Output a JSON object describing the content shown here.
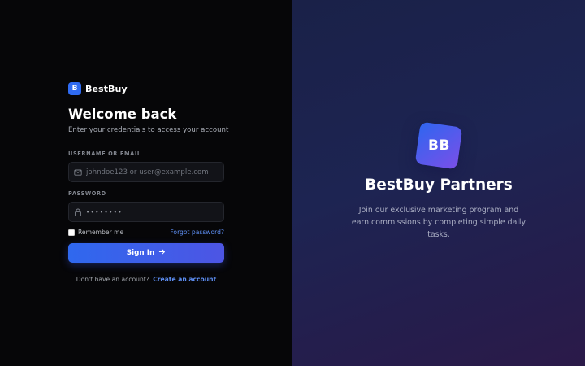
{
  "brand": {
    "logo_letter": "B",
    "name": "BestBuy"
  },
  "login": {
    "title": "Welcome back",
    "subtitle": "Enter your credentials to access your account",
    "username_label": "USERNAME OR EMAIL",
    "username_placeholder": "johndoe123 or user@example.com",
    "password_label": "PASSWORD",
    "password_placeholder": "••••••••",
    "remember_label": "Remember me",
    "remember_checked": false,
    "forgot_label": "Forgot password?",
    "signin_label": "Sign In",
    "signup_prompt": "Don't have an account?",
    "signup_link": "Create an account"
  },
  "hero": {
    "logo_text": "BB",
    "title": "BestBuy Partners",
    "description": "Join our exclusive marketing program and earn commissions by completing simple daily tasks."
  },
  "icons": {
    "username": "mail-icon",
    "password": "lock-icon",
    "signin": "arrow-right-icon"
  },
  "colors": {
    "accent": "#2f6bf2",
    "link": "#5e8ff5",
    "left_bg": "#060608",
    "right_bg": "#1d2452"
  }
}
